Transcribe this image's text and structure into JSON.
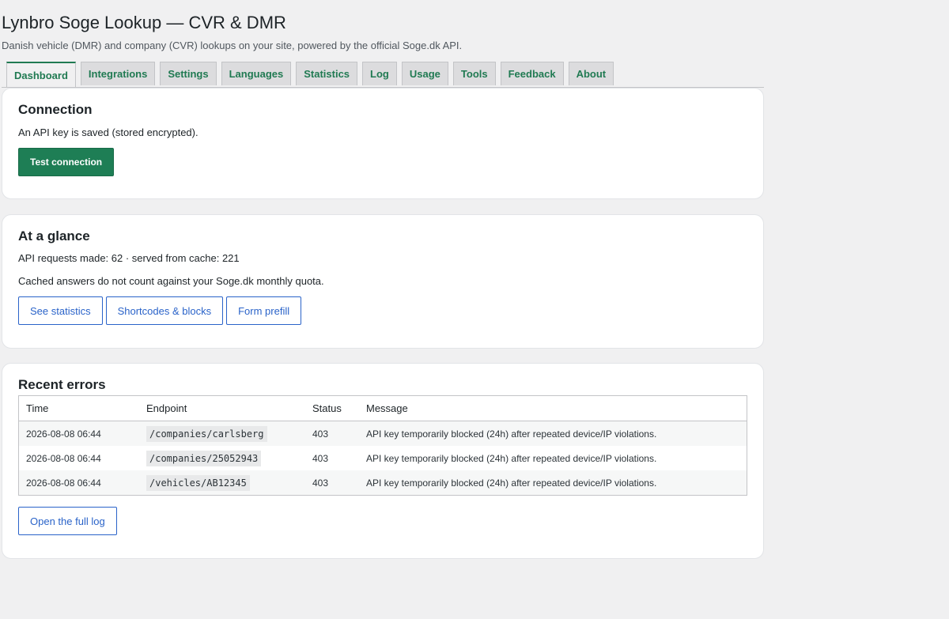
{
  "header": {
    "title": "Lynbro Soge Lookup — CVR & DMR",
    "subtitle": "Danish vehicle (DMR) and company (CVR) lookups on your site, powered by the official Soge.dk API."
  },
  "tabs": [
    {
      "label": "Dashboard",
      "active": true
    },
    {
      "label": "Integrations"
    },
    {
      "label": "Settings"
    },
    {
      "label": "Languages"
    },
    {
      "label": "Statistics"
    },
    {
      "label": "Log"
    },
    {
      "label": "Usage"
    },
    {
      "label": "Tools"
    },
    {
      "label": "Feedback"
    },
    {
      "label": "About"
    }
  ],
  "connection": {
    "heading": "Connection",
    "status": "An API key is saved (stored encrypted).",
    "test_button": "Test connection"
  },
  "glance": {
    "heading": "At a glance",
    "stats": "API requests made: 62 · served from cache: 221",
    "note": "Cached answers do not count against your Soge.dk monthly quota.",
    "buttons": [
      "See statistics",
      "Shortcodes & blocks",
      "Form prefill"
    ]
  },
  "errors": {
    "heading": "Recent errors",
    "columns": [
      "Time",
      "Endpoint",
      "Status",
      "Message"
    ],
    "rows": [
      {
        "time": "2026-08-08 06:44",
        "endpoint": "/companies/carlsberg",
        "status": "403",
        "message": "API key temporarily blocked (24h) after repeated device/IP violations."
      },
      {
        "time": "2026-08-08 06:44",
        "endpoint": "/companies/25052943",
        "status": "403",
        "message": "API key temporarily blocked (24h) after repeated device/IP violations."
      },
      {
        "time": "2026-08-08 06:44",
        "endpoint": "/vehicles/AB12345",
        "status": "403",
        "message": "API key temporarily blocked (24h) after repeated device/IP violations."
      }
    ],
    "log_button": "Open the full log"
  },
  "colors": {
    "accent": "#1e7e55",
    "link": "#2a63c9",
    "tab_text": "#207a52"
  }
}
